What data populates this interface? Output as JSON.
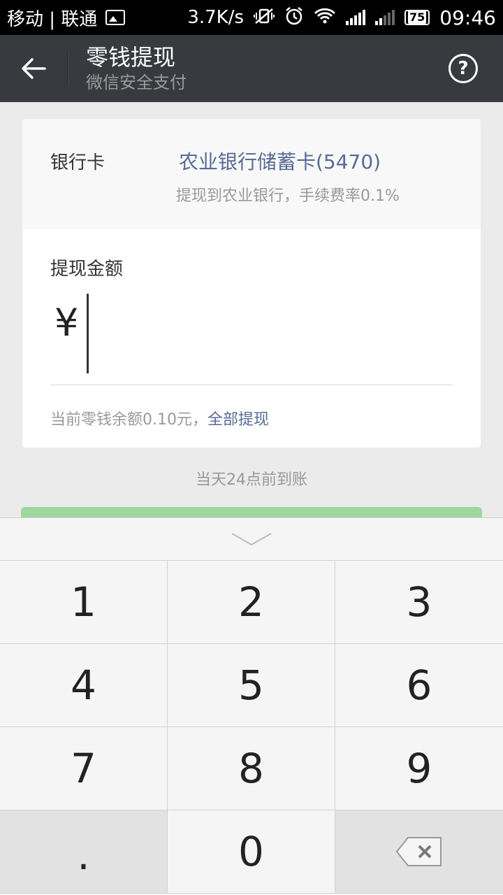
{
  "status_bar": {
    "carrier": "移动 | 联通",
    "speed": "3.7K/s",
    "battery": "75",
    "time": "09:46"
  },
  "header": {
    "title": "零钱提现",
    "subtitle": "微信安全支付"
  },
  "bank": {
    "label": "银行卡",
    "card_name": "农业银行储蓄卡(5470)",
    "description": "提现到农业银行，手续费率0.1%"
  },
  "amount": {
    "label": "提现金额",
    "currency": "¥",
    "value": "",
    "balance_text": "当前零钱余额0.10元，",
    "withdraw_all": "全部提现"
  },
  "arrival_note": "当天24点前到账",
  "keyboard": {
    "keys": [
      "1",
      "2",
      "3",
      "4",
      "5",
      "6",
      "7",
      "8",
      "9",
      ".",
      "0"
    ]
  },
  "colors": {
    "action_bar": "#393a3f",
    "link": "#576b95",
    "confirm_disabled": "#9fd79d"
  }
}
